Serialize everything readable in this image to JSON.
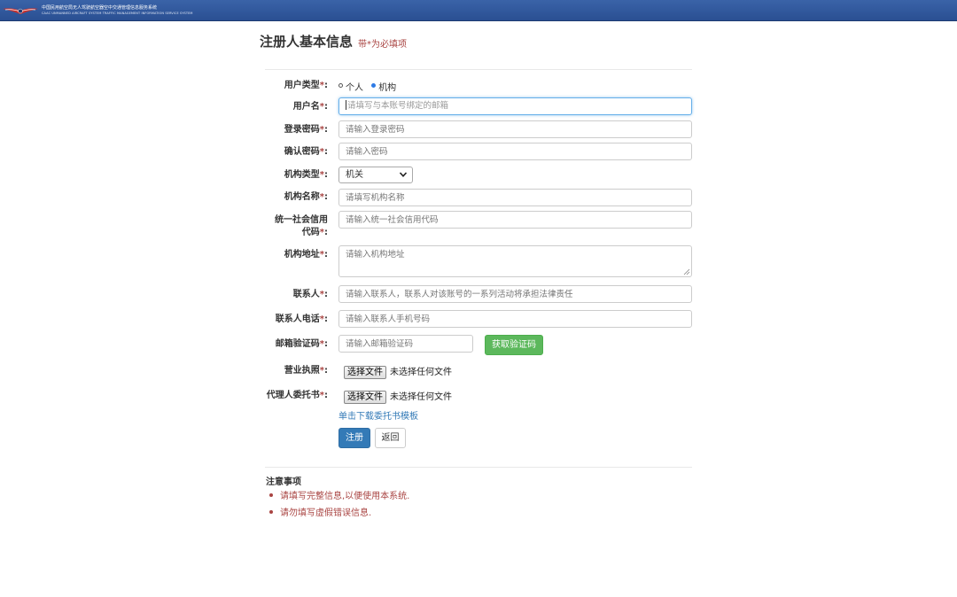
{
  "header": {
    "system_name_cn": "中国民用航空局无人驾驶航空器空中交通管理信息服务系统",
    "system_name_en": "CAAC UNMANNED AIRCRAFT SYSTEM TRAFFIC MANAGEMENT INFORMATION SERVICE SYSTEM",
    "brand_color": "#2a4f92"
  },
  "page": {
    "title": "注册人基本信息",
    "subtitle": "带*为必填项"
  },
  "form": {
    "required_mark": "*",
    "user_type": {
      "label": "用户类型",
      "options": [
        "个人",
        "机构"
      ],
      "selected": "机构"
    },
    "username": {
      "label": "用户名",
      "placeholder": "请填写与本账号绑定的邮箱",
      "value": ""
    },
    "password": {
      "label": "登录密码",
      "placeholder": "请输入登录密码",
      "value": ""
    },
    "confirm_password": {
      "label": "确认密码",
      "placeholder": "请输入密码",
      "value": ""
    },
    "org_type": {
      "label": "机构类型",
      "selected": "机关"
    },
    "org_name": {
      "label": "机构名称",
      "placeholder": "请填写机构名称",
      "value": ""
    },
    "credit_code": {
      "label_line1": "统一社会信用",
      "label_line2": "代码",
      "placeholder": "请输入统一社会信用代码",
      "value": ""
    },
    "org_address": {
      "label": "机构地址",
      "placeholder": "请输入机构地址",
      "value": ""
    },
    "contact": {
      "label": "联系人",
      "placeholder": "请输入联系人，联系人对该账号的一系列活动将承担法律责任",
      "value": ""
    },
    "contact_phone": {
      "label": "联系人电话",
      "placeholder": "请输入联系人手机号码",
      "value": ""
    },
    "email_code": {
      "label": "邮箱验证码",
      "placeholder": "请输入邮箱验证码",
      "value": "",
      "button": "获取验证码"
    },
    "business_license": {
      "label": "营业执照",
      "button": "选择文件",
      "status": "未选择任何文件"
    },
    "power_of_attorney": {
      "label": "代理人委托书",
      "button": "选择文件",
      "status": "未选择任何文件"
    },
    "template_link": "单击下载委托书模板",
    "submit": "注册",
    "back": "返回"
  },
  "notes": {
    "title": "注意事项",
    "items": [
      "请填写完整信息,以便使用本系统.",
      "请勿填写虚假错误信息."
    ]
  },
  "colors": {
    "required": "#a94442",
    "primary": "#337ab7",
    "success": "#5cb85c"
  }
}
